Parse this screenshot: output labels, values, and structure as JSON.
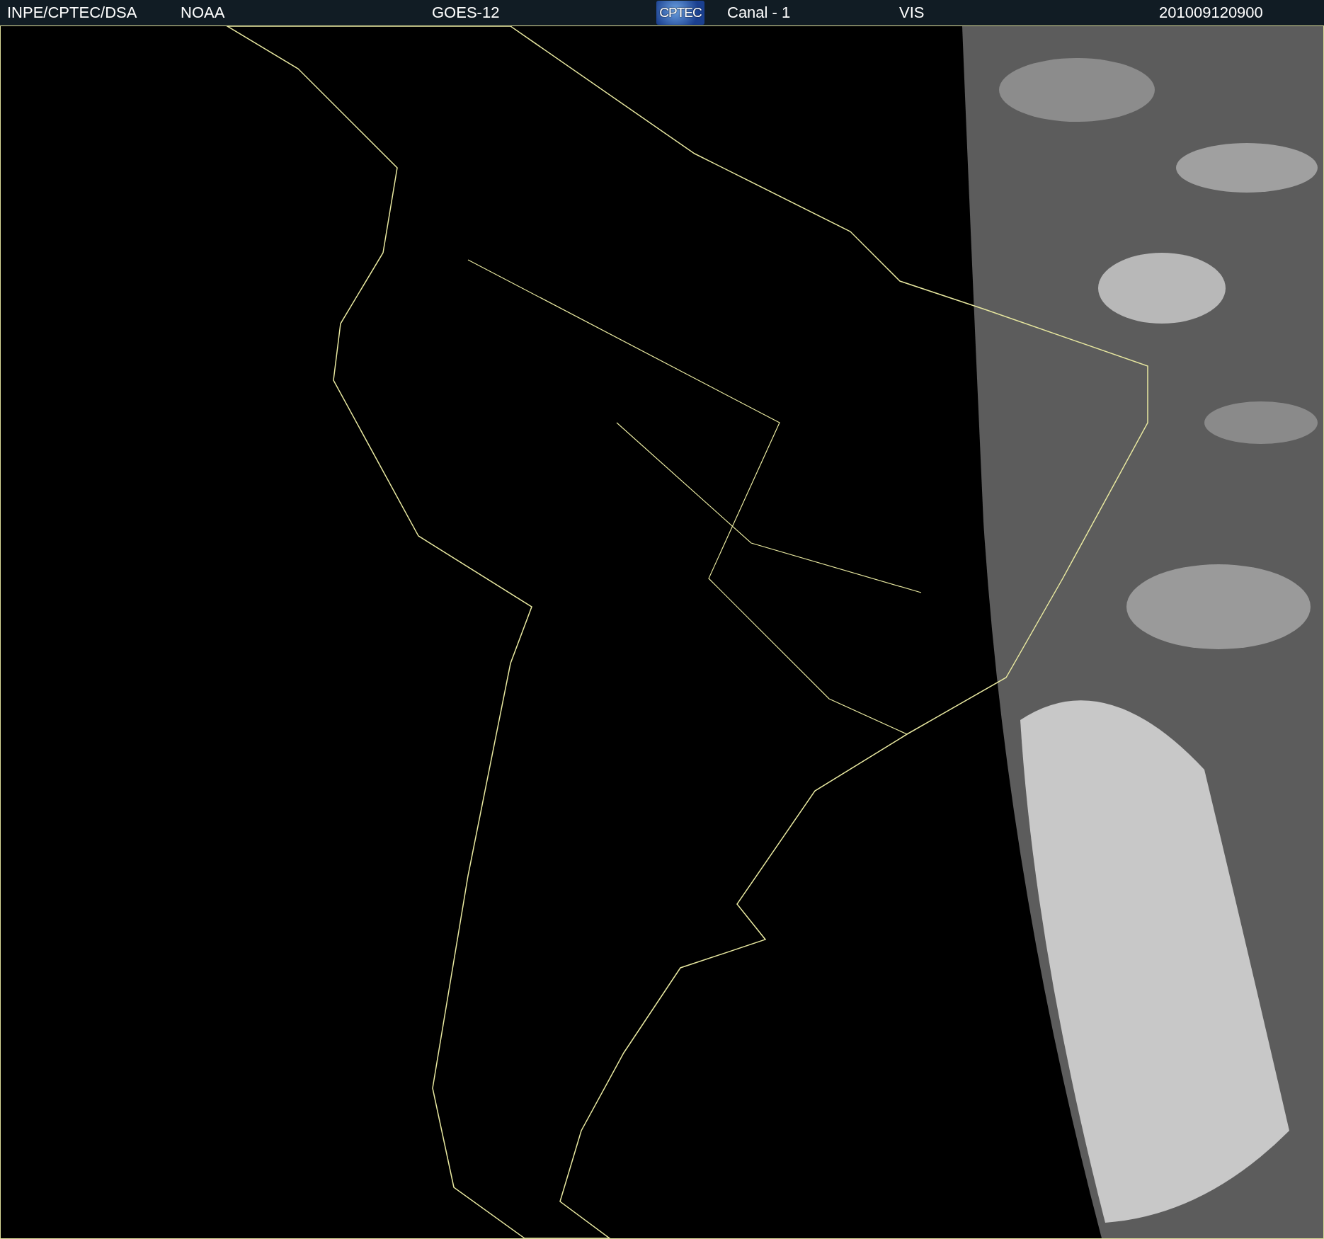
{
  "header": {
    "items": [
      {
        "kind": "text",
        "text": "INPE/CPTEC/DSA"
      },
      {
        "kind": "text",
        "text": "NOAA"
      },
      {
        "kind": "text",
        "text": "GOES-12"
      },
      {
        "kind": "logo",
        "text": "CPTEC"
      },
      {
        "kind": "text",
        "text": "Canal - 1"
      },
      {
        "kind": "text",
        "text": "VIS"
      },
      {
        "kind": "text",
        "text": "201009120900"
      }
    ]
  }
}
